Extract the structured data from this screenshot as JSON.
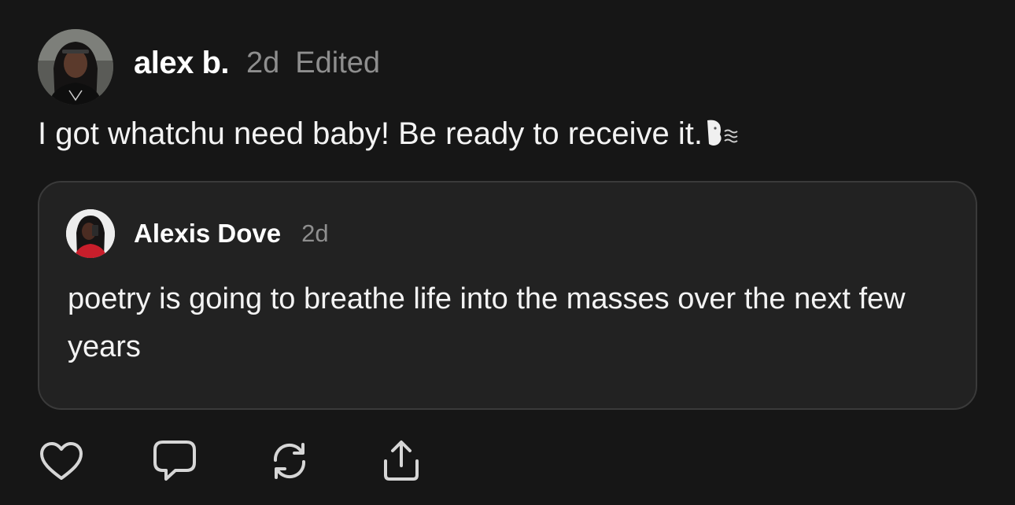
{
  "post": {
    "author": "alex b.",
    "time": "2d",
    "edited": "Edited",
    "text": "I got whatchu need baby! Be ready to receive it.",
    "emoji": "face-exhaling-icon"
  },
  "quoted_post": {
    "author": "Alexis Dove",
    "time": "2d",
    "text": "poetry is going to breathe life into the masses over the next few years"
  },
  "actions": [
    {
      "name": "like",
      "icon": "heart-icon"
    },
    {
      "name": "reply",
      "icon": "comment-icon"
    },
    {
      "name": "repost",
      "icon": "repost-icon"
    },
    {
      "name": "share",
      "icon": "share-icon"
    }
  ],
  "colors": {
    "background": "#161616",
    "card_background": "#222222",
    "card_border": "#3a3a3a",
    "muted_text": "#8e8e8e",
    "icon": "#d6d6d6"
  }
}
